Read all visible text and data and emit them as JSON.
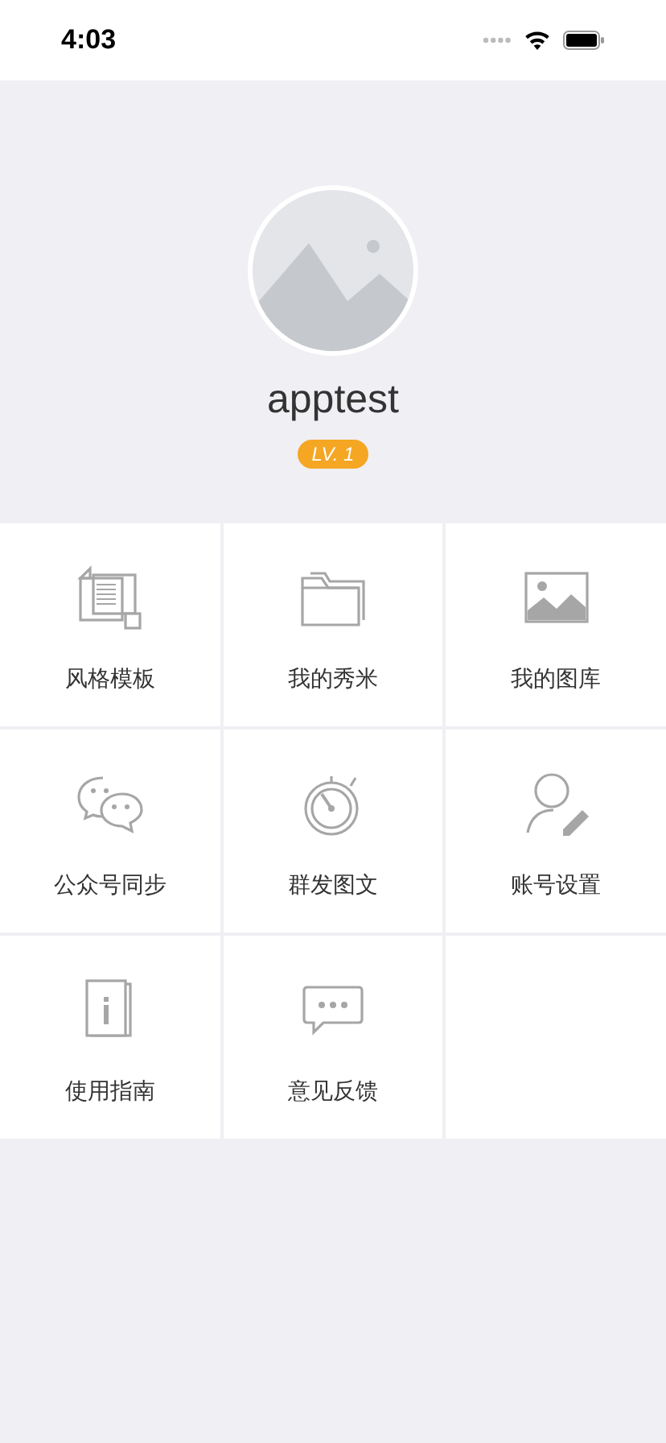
{
  "status_bar": {
    "time": "4:03"
  },
  "profile": {
    "username": "apptest",
    "level_badge": "LV. 1"
  },
  "menu_items": [
    {
      "label": "风格模板",
      "kind": "template"
    },
    {
      "label": "我的秀米",
      "kind": "folder"
    },
    {
      "label": "我的图库",
      "kind": "gallery"
    },
    {
      "label": "公众号同步",
      "kind": "chat"
    },
    {
      "label": "群发图文",
      "kind": "stopwatch"
    },
    {
      "label": "账号设置",
      "kind": "account"
    },
    {
      "label": "使用指南",
      "kind": "guide"
    },
    {
      "label": "意见反馈",
      "kind": "feedback"
    }
  ]
}
